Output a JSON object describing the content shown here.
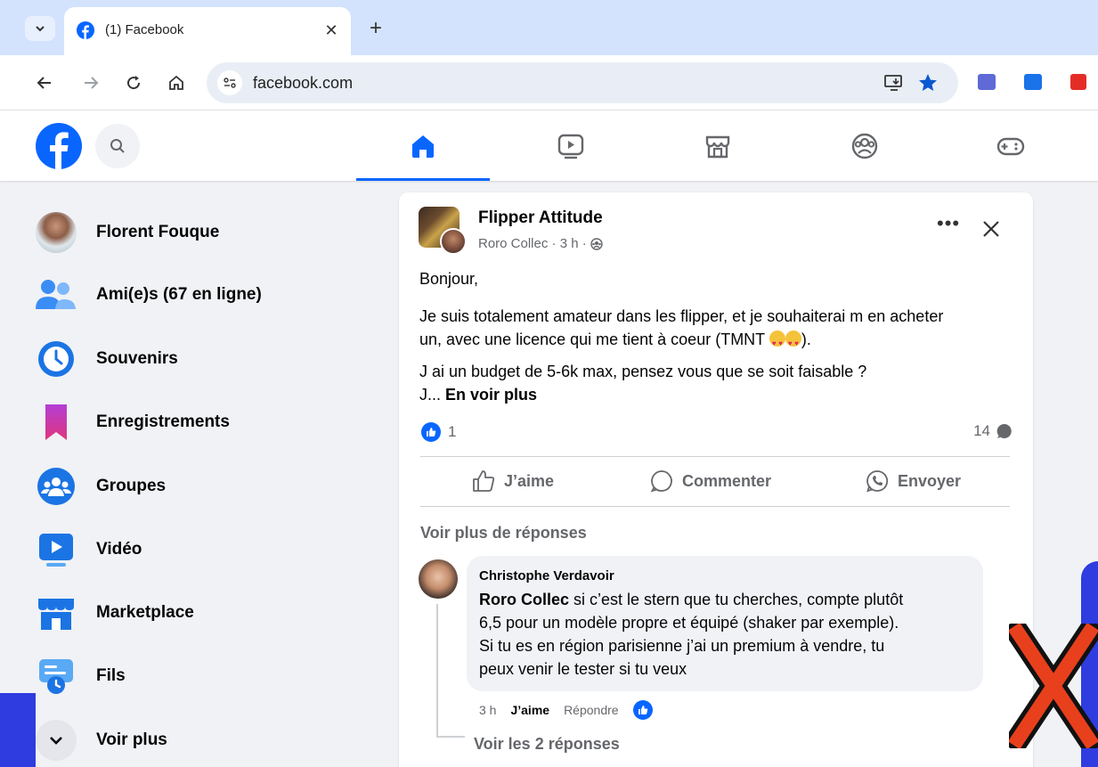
{
  "browser": {
    "tab_title": "(1) Facebook",
    "url": "facebook.com"
  },
  "sidebar": {
    "items": [
      {
        "label": "Florent Fouque",
        "icon": "profile-avatar"
      },
      {
        "label": "Ami(e)s (67 en ligne)",
        "icon": "friends-icon"
      },
      {
        "label": "Souvenirs",
        "icon": "memories-icon"
      },
      {
        "label": "Enregistrements",
        "icon": "saved-icon"
      },
      {
        "label": "Groupes",
        "icon": "groups-icon"
      },
      {
        "label": "Vidéo",
        "icon": "video-icon"
      },
      {
        "label": "Marketplace",
        "icon": "marketplace-icon"
      },
      {
        "label": "Fils",
        "icon": "feeds-icon"
      },
      {
        "label": "Voir plus",
        "icon": "chevron-down-icon"
      }
    ]
  },
  "post": {
    "group_name": "Flipper Attitude",
    "meta": "Roro Collec · 3 h ·",
    "text_greeting": "Bonjour,",
    "text_line1": "Je suis totalement amateur dans les flipper, et je souhaiterai m en acheter",
    "text_line2_prefix": "un, avec une licence qui me tient à coeur (TMNT ",
    "text_line2_suffix": ").",
    "text_line3": "J ai un budget de 5-6k max, pensez vous que se soit faisable ?",
    "text_line4": "J... ",
    "see_more": "En voir plus",
    "like_count": "1",
    "comment_count": "14",
    "actions": {
      "like": "J’aime",
      "comment": "Commenter",
      "send": "Envoyer"
    },
    "more_replies": "Voir plus de réponses"
  },
  "comment": {
    "author": "Christophe Verdavoir",
    "mention": "Roro Collec",
    "text_line1": " si c’est le stern que tu cherches, compte plutôt",
    "text_line2": "6,5 pour un modèle propre et équipé (shaker par exemple).",
    "text_line3": "Si tu es en région parisienne j’ai un premium à vendre, tu",
    "text_line4": "peux venir le tester si tu veux",
    "time": "3 h",
    "like": "J’aime",
    "reply": "Répondre",
    "view_replies": "Voir les 2 réponses"
  },
  "colors": {
    "facebook_blue": "#0866ff",
    "overlay_blue": "#2f3ce0",
    "overlay_red_x": "#e8401c"
  }
}
